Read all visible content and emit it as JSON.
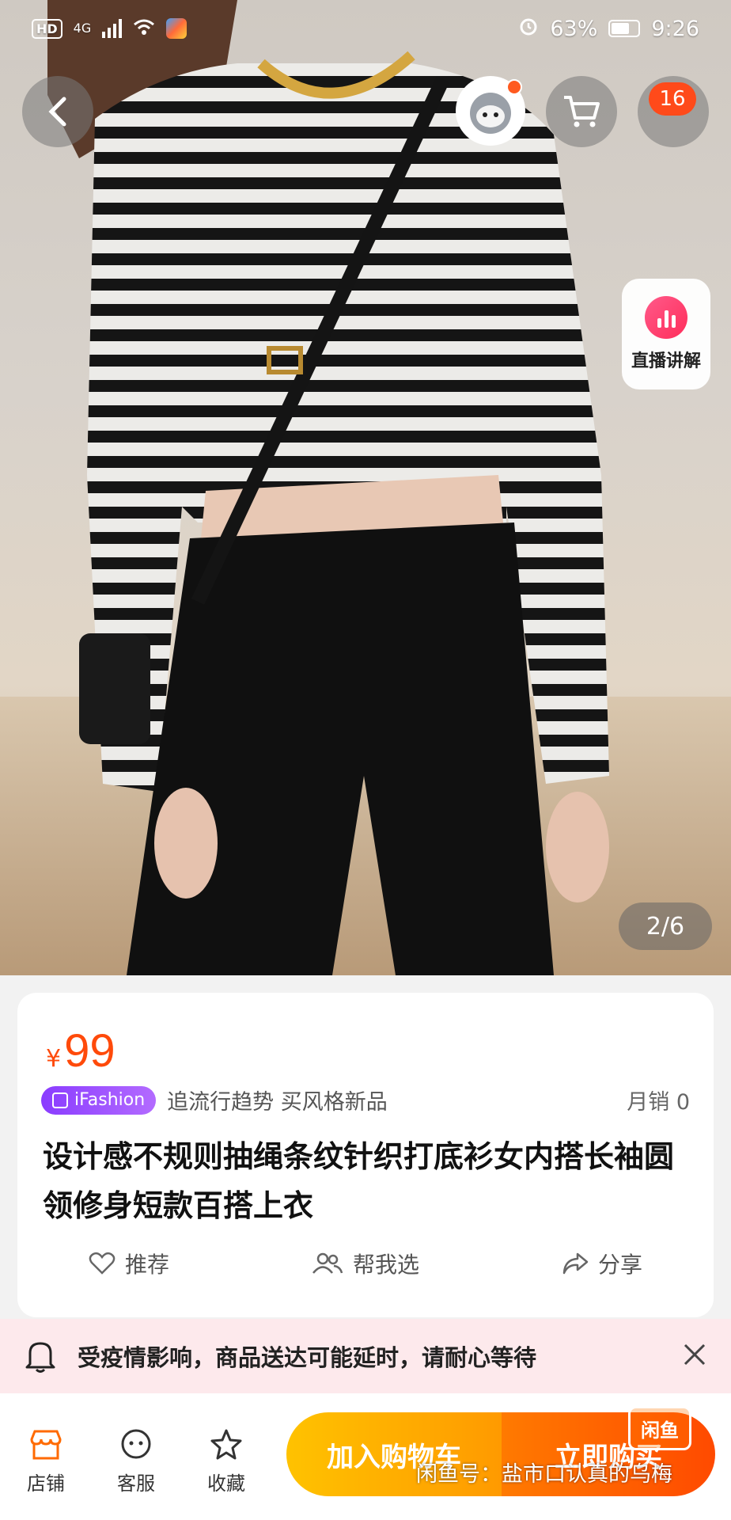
{
  "status_bar": {
    "hd": "HD",
    "network": "4G",
    "battery": "63%",
    "time": "9:26"
  },
  "header": {
    "cart_count": "16",
    "live_label": "直播讲解"
  },
  "gallery": {
    "pager": "2/6"
  },
  "product": {
    "price_symbol": "¥",
    "price": "99",
    "tag": "iFashion",
    "slogan": "追流行趋势 买风格新品",
    "sales": "月销  0",
    "title": "设计感不规则抽绳条纹针织打底衫女内搭长袖圆领修身短款百搭上衣",
    "actions": [
      {
        "label": "推荐",
        "icon": "heart-icon"
      },
      {
        "label": "帮我选",
        "icon": "people-icon"
      },
      {
        "label": "分享",
        "icon": "share-icon"
      }
    ]
  },
  "notice": {
    "text": "受疫情影响，商品送达可能延时，请耐心等待"
  },
  "bottom_bar": {
    "shop": "店铺",
    "service": "客服",
    "favorite": "收藏",
    "add_to_cart": "加入购物车",
    "buy_now": "立即购买"
  },
  "watermark": {
    "text": "闲鱼号：盐市口认真的乌梅",
    "logo": "闲鱼"
  },
  "colors": {
    "accent": "#ff4a0a",
    "cart_button": "#ffb000",
    "buy_button": "#ff5a00",
    "ifashion": "#9b4dff",
    "notice_bg": "#fde9ec"
  }
}
